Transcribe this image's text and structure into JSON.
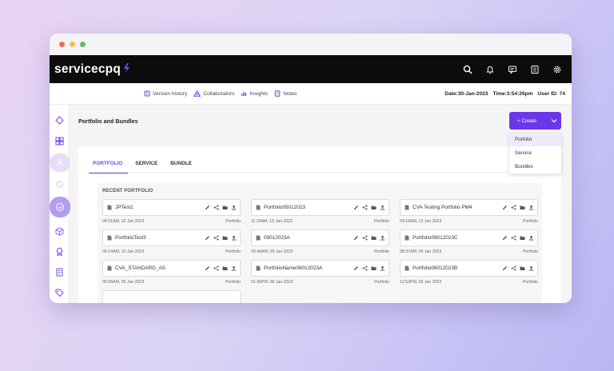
{
  "navbar": {
    "logo": "servicecpq",
    "icons": [
      "search-icon",
      "bell-icon",
      "message-icon",
      "list-icon",
      "gear-icon"
    ]
  },
  "infobar": {
    "links": [
      {
        "label": "Version history",
        "icon": "version-icon"
      },
      {
        "label": "Collaborators",
        "icon": "collaborators-icon"
      },
      {
        "label": "Insights",
        "icon": "insights-icon"
      },
      {
        "label": "Notes",
        "icon": "notes-icon"
      }
    ],
    "date": "Date:30-Jan-2023",
    "time": "Time:3:54:26pm",
    "user": "User ID: 74"
  },
  "page": {
    "title": "Portfolio and Bundles",
    "create_label": "+ Create"
  },
  "dropdown": {
    "items": [
      "Porfolio",
      "Service",
      "Bundles"
    ],
    "selected": "Porfolio"
  },
  "tabs": [
    "PORTFOLIO",
    "SERVICE",
    "BUNDLE"
  ],
  "active_tab": "PORTFOLIO",
  "recent": {
    "title": "RECENT PORTFOLIO",
    "cards": [
      {
        "name": "JPTest1",
        "time": "06:51AM, 16 Jan 2023",
        "type": "Portfolio"
      },
      {
        "name": "Portfolio05012023",
        "time": "11:20AM, 15 Jan 2023",
        "type": "Portfolio"
      },
      {
        "name": "CVA Testing Portfolio PM4",
        "time": "09:18AM, 13 Jan 2023",
        "type": "Portfolio"
      },
      {
        "name": "PortfolioTest3",
        "time": "06:14AM, 10 Jan 2023",
        "type": "Portfolio"
      },
      {
        "name": "09012023A",
        "time": "09:40AM, 09 Jan 2023",
        "type": "Portfolio"
      },
      {
        "name": "Portfolio09012023C",
        "time": "08:37AM, 09 Jan 2023",
        "type": "Portfolio"
      },
      {
        "name": "CVA_STANDARD_AS",
        "time": "05:56AM, 09 Jan 2023",
        "type": "Portfolio"
      },
      {
        "name": "PortfolioName06012023A",
        "time": "01:36PM, 06 Jan 2023",
        "type": "Portfolio"
      },
      {
        "name": "Portfolio06012023B",
        "time": "12:53PM, 06 Jan 2023",
        "type": "Portfolio"
      }
    ]
  },
  "colors": {
    "accent": "#6a38e8",
    "navbar": "#0c0c0c",
    "sidebar_active": "#b49cf0"
  }
}
